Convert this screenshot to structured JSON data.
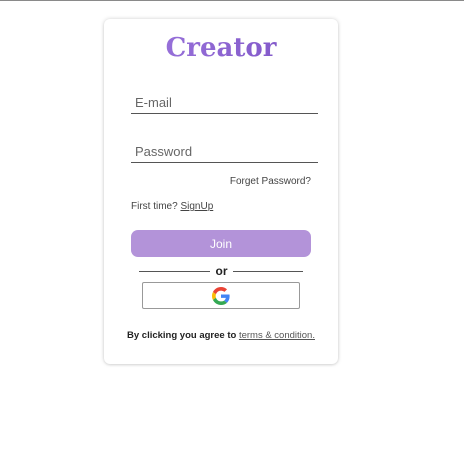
{
  "logo": {
    "text": "Creator",
    "gradient": [
      "#a07be0",
      "#7a4fc3"
    ]
  },
  "form": {
    "email_placeholder": "E-mail",
    "password_placeholder": "Password",
    "forgot_label": "Forget Password?",
    "first_time_label": "First time?",
    "signup_label": "SignUp",
    "join_label": "Join",
    "or_label": "or",
    "google_icon": "google-icon"
  },
  "footer": {
    "agree_text": "By clicking you agree to",
    "terms_label": "terms & condition."
  },
  "colors": {
    "accent": "#b393d9",
    "logo_purple": "#8f6bd3",
    "google_blue": "#4285F4",
    "google_red": "#EA4335",
    "google_yellow": "#FBBC05",
    "google_green": "#34A853"
  }
}
